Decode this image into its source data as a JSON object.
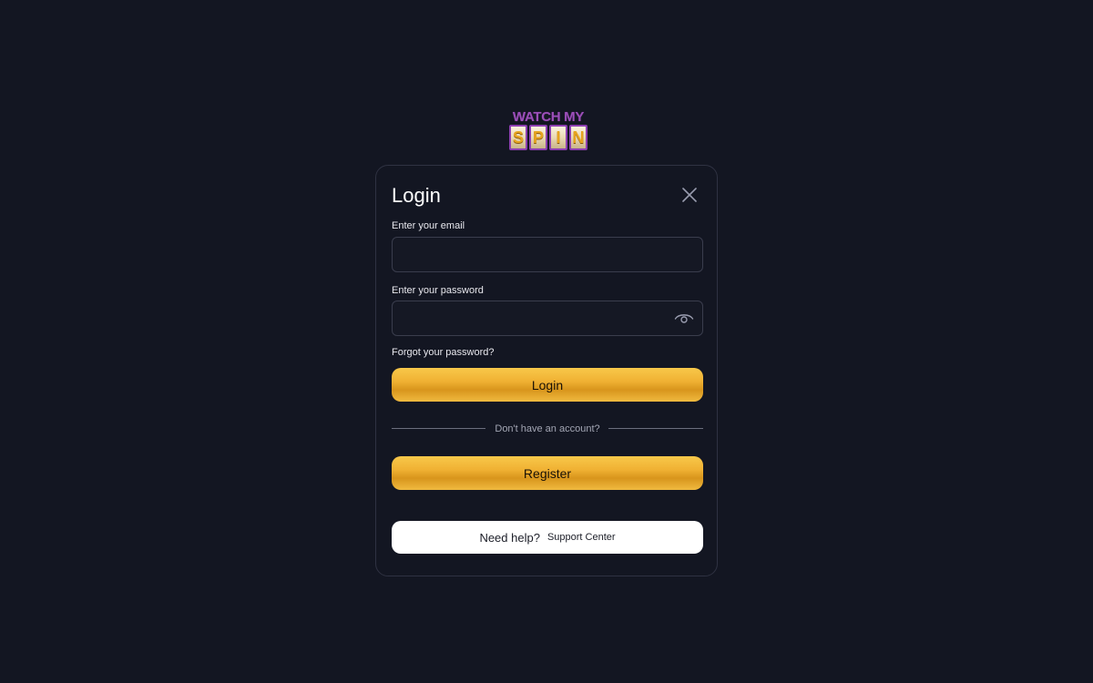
{
  "logo": {
    "top_text": "WATCH MY",
    "reels": [
      "S",
      "P",
      "I",
      "N"
    ]
  },
  "login": {
    "title": "Login",
    "close_icon": "close-icon",
    "email_label": "Enter your email",
    "email_value": "",
    "password_label": "Enter your password",
    "password_value": "",
    "eye_icon": "eye-icon",
    "forgot_link": "Forgot your password?",
    "login_button": "Login",
    "divider_text": "Don't have an account?",
    "register_button": "Register",
    "help_text": "Need help?",
    "support_link": "Support Center"
  },
  "colors": {
    "background": "#131622",
    "accent_gold": "#f0b133",
    "logo_purple": "#9b4fb8"
  }
}
